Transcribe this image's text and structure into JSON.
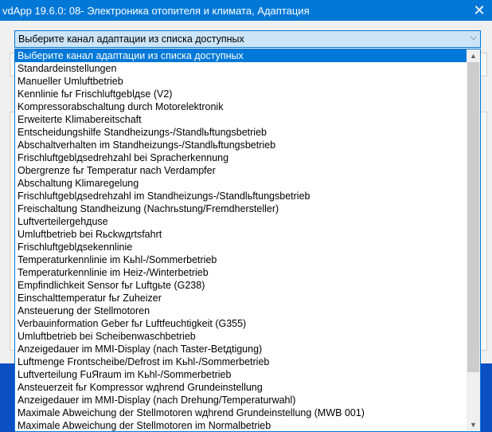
{
  "window": {
    "title": "vdApp 19.6.0: 08- Электроника отопителя и климата, Адаптация"
  },
  "combo": {
    "selected": "Выберите канал адаптации из списка доступных"
  },
  "scrollbar": {
    "position_fraction": 0.0,
    "visible_fraction": 0.87
  },
  "options": [
    "Выберите канал адаптации из списка доступных",
    "Standardeinstellungen",
    "Manueller Umluftbetrieb",
    "Kennlinie fьr Frischluftgeblдse (V2)",
    "Kompressorabschaltung durch Motorelektronik",
    "Erweiterte Klimabereitschaft",
    "Entscheidungshilfe Standheizungs-/Standlьftungsbetrieb",
    "Abschaltverhalten im Standheizungs-/Standlьftungsbetrieb",
    "Frischluftgeblдsedrehzahl bei Spracherkennung",
    "Obergrenze fьr Temperatur nach Verdampfer",
    "Abschaltung Klimaregelung",
    "Frischluftgeblдsedrehzahl im Standheizungs-/Standlьftungsbetrieb",
    "Freischaltung Standheizung (Nachrьstung/Fremdhersteller)",
    "Luftverteilergehдuse",
    "Umluftbetrieb bei Rьckwдrtsfahrt",
    "Frischluftgeblдsekennlinie",
    "Temperaturkennlinie im Kьhl-/Sommerbetrieb",
    "Temperaturkennlinie im Heiz-/Winterbetrieb",
    "Empfindlichkeit Sensor fьr Luftgьte (G238)",
    "Einschalttemperatur fьr Zuheizer",
    "Ansteuerung der Stellmotoren",
    "Verbauinformation Geber fьr Luftfeuchtigkeit (G355)",
    "Umluftbetrieb bei Scheibenwaschbetrieb",
    "Anzeigedauer im MMI-Display (nach Taster-Betдtigung)",
    "Luftmenge Frontscheibe/Defrost im Kьhl-/Sommerbetrieb",
    "Luftverteilung FuЯraum im Kьhl-/Sommerbetrieb",
    "Ansteuerzeit fьr Kompressor wдhrend Grundeinstellung",
    "Anzeigedauer im MMI-Display (nach Drehung/Temperaturwahl)",
    "Maximale Abweichung der Stellmotoren wдhrend Grundeinstellung (MWB 001)",
    "Maximale Abweichung der Stellmotoren im Normalbetrieb"
  ]
}
